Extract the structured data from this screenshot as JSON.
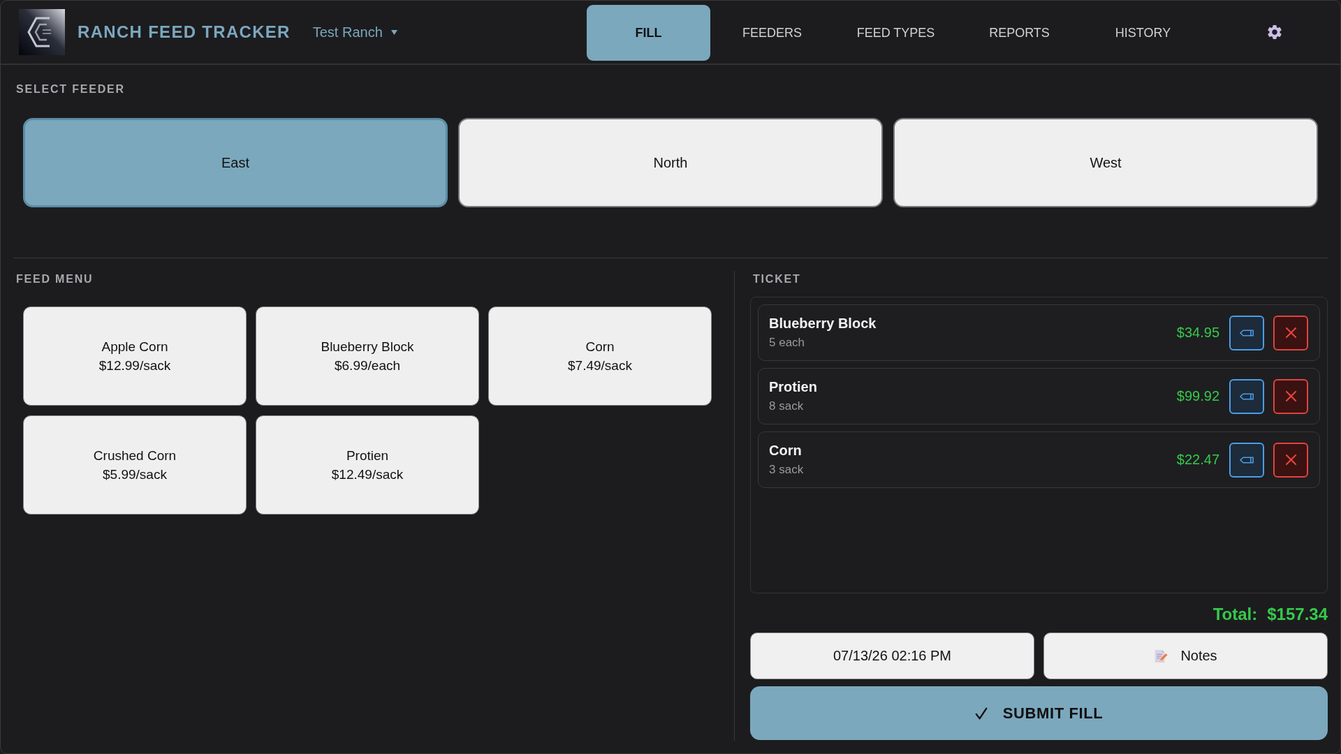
{
  "app": {
    "title": "RANCH FEED TRACKER",
    "ranch": "Test Ranch"
  },
  "tabs": [
    {
      "label": "FILL",
      "selected": true
    },
    {
      "label": "FEEDERS",
      "selected": false
    },
    {
      "label": "FEED TYPES",
      "selected": false
    },
    {
      "label": "REPORTS",
      "selected": false
    },
    {
      "label": "HISTORY",
      "selected": false
    }
  ],
  "select_feeder": {
    "heading": "SELECT FEEDER",
    "feeders": [
      {
        "name": "East",
        "selected": true
      },
      {
        "name": "North",
        "selected": false
      },
      {
        "name": "West",
        "selected": false
      }
    ]
  },
  "feed_menu": {
    "heading": "FEED MENU",
    "items": [
      {
        "name": "Apple Corn",
        "price": "$12.99/sack"
      },
      {
        "name": "Blueberry Block",
        "price": "$6.99/each"
      },
      {
        "name": "Corn",
        "price": "$7.49/sack"
      },
      {
        "name": "Crushed Corn",
        "price": "$5.99/sack"
      },
      {
        "name": "Protien",
        "price": "$12.49/sack"
      }
    ]
  },
  "ticket": {
    "heading": "TICKET",
    "items": [
      {
        "name": "Blueberry Block",
        "quantity": "5 each",
        "amount": "$34.95"
      },
      {
        "name": "Protien",
        "quantity": "8 sack",
        "amount": "$99.92"
      },
      {
        "name": "Corn",
        "quantity": "3 sack",
        "amount": "$22.47"
      }
    ],
    "total_label": "Total:",
    "total": "$157.34",
    "date": "07/13/26 02:16 PM",
    "notes": "Notes",
    "submit": "SUBMIT FILL"
  }
}
